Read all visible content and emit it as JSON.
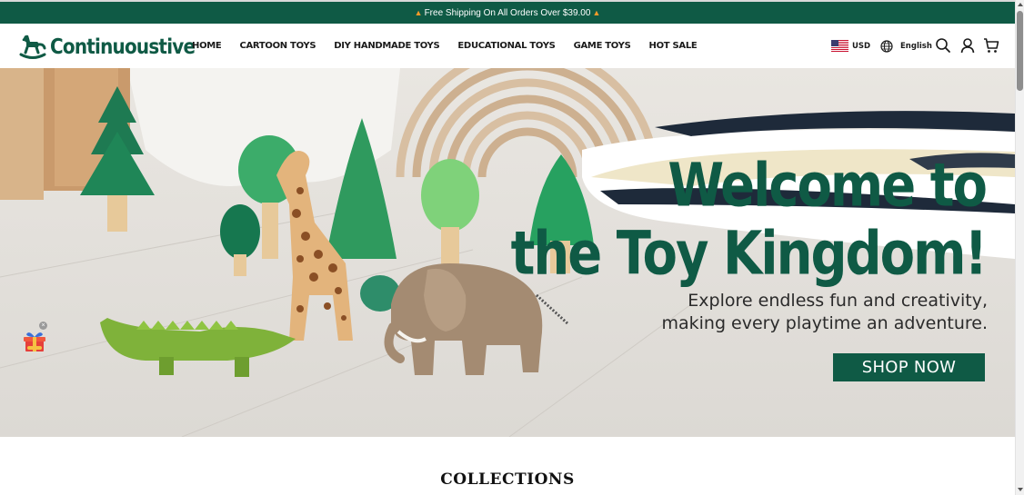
{
  "announcement": {
    "text": "Free Shipping On All Orders Over $39.00",
    "icon": "flame-icon"
  },
  "header": {
    "logo_text": "Continuoustive",
    "nav": [
      {
        "label": "HOME"
      },
      {
        "label": "CARTOON TOYS"
      },
      {
        "label": "DIY HANDMADE TOYS"
      },
      {
        "label": "EDUCATIONAL TOYS"
      },
      {
        "label": "GAME TOYS"
      },
      {
        "label": "HOT SALE"
      }
    ],
    "currency": "USD",
    "language": "English",
    "icons": [
      "us-flag-icon",
      "globe-icon",
      "search-icon",
      "account-icon",
      "cart-icon"
    ]
  },
  "hero": {
    "title_line1": "Welcome to",
    "title_line2": "the Toy Kingdom!",
    "subtitle_line1": "Explore endless fun and creativity,",
    "subtitle_line2": "making every playtime an adventure.",
    "cta_label": "SHOP NOW"
  },
  "collections_heading": "COLLECTIONS",
  "colors": {
    "brand_green": "#0f5a45",
    "announcement_bg": "#0f5a45",
    "hero_bg": "#e7e4df"
  }
}
